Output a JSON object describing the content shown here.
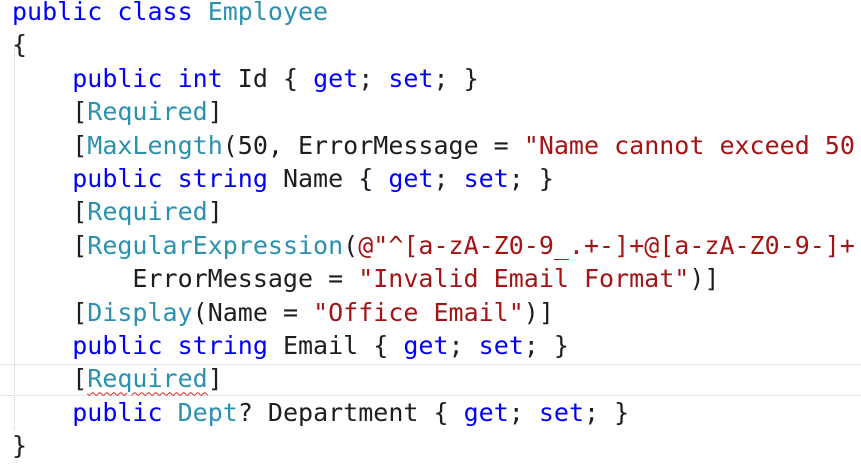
{
  "code": {
    "lines": [
      {
        "indent": "",
        "tokens": [
          {
            "t": "kw",
            "v": "public"
          },
          {
            "t": "id",
            "v": " "
          },
          {
            "t": "kw",
            "v": "class"
          },
          {
            "t": "id",
            "v": " "
          },
          {
            "t": "ty",
            "v": "Employee"
          }
        ]
      },
      {
        "indent": "",
        "tokens": [
          {
            "t": "id",
            "v": "{"
          }
        ]
      },
      {
        "indent": "    ",
        "tokens": [
          {
            "t": "kw",
            "v": "public"
          },
          {
            "t": "id",
            "v": " "
          },
          {
            "t": "kw",
            "v": "int"
          },
          {
            "t": "id",
            "v": " Id { "
          },
          {
            "t": "kw",
            "v": "get"
          },
          {
            "t": "id",
            "v": "; "
          },
          {
            "t": "kw",
            "v": "set"
          },
          {
            "t": "id",
            "v": "; }"
          }
        ]
      },
      {
        "indent": "    ",
        "tokens": [
          {
            "t": "id",
            "v": "["
          },
          {
            "t": "ty",
            "v": "Required"
          },
          {
            "t": "id",
            "v": "]"
          }
        ]
      },
      {
        "indent": "    ",
        "tokens": [
          {
            "t": "id",
            "v": "["
          },
          {
            "t": "ty",
            "v": "MaxLength"
          },
          {
            "t": "id",
            "v": "(50, ErrorMessage = "
          },
          {
            "t": "st",
            "v": "\"Name cannot exceed 50"
          }
        ]
      },
      {
        "indent": "    ",
        "tokens": [
          {
            "t": "kw",
            "v": "public"
          },
          {
            "t": "id",
            "v": " "
          },
          {
            "t": "kw",
            "v": "string"
          },
          {
            "t": "id",
            "v": " Name { "
          },
          {
            "t": "kw",
            "v": "get"
          },
          {
            "t": "id",
            "v": "; "
          },
          {
            "t": "kw",
            "v": "set"
          },
          {
            "t": "id",
            "v": "; }"
          }
        ]
      },
      {
        "indent": "    ",
        "tokens": [
          {
            "t": "id",
            "v": "["
          },
          {
            "t": "ty",
            "v": "Required"
          },
          {
            "t": "id",
            "v": "]"
          }
        ]
      },
      {
        "indent": "    ",
        "tokens": [
          {
            "t": "id",
            "v": "["
          },
          {
            "t": "ty",
            "v": "RegularExpression"
          },
          {
            "t": "id",
            "v": "("
          },
          {
            "t": "st",
            "v": "@\"^[a-zA-Z0-9_.+-]+@[a-zA-Z0-9-]+"
          }
        ]
      },
      {
        "indent": "        ",
        "tokens": [
          {
            "t": "id",
            "v": "ErrorMessage = "
          },
          {
            "t": "st",
            "v": "\"Invalid Email Format\""
          },
          {
            "t": "id",
            "v": ")]"
          }
        ]
      },
      {
        "indent": "    ",
        "tokens": [
          {
            "t": "id",
            "v": "["
          },
          {
            "t": "ty",
            "v": "Display"
          },
          {
            "t": "id",
            "v": "(Name = "
          },
          {
            "t": "st",
            "v": "\"Office Email\""
          },
          {
            "t": "id",
            "v": ")]"
          }
        ]
      },
      {
        "indent": "    ",
        "tokens": [
          {
            "t": "kw",
            "v": "public"
          },
          {
            "t": "id",
            "v": " "
          },
          {
            "t": "kw",
            "v": "string"
          },
          {
            "t": "id",
            "v": " Email { "
          },
          {
            "t": "kw",
            "v": "get"
          },
          {
            "t": "id",
            "v": "; "
          },
          {
            "t": "kw",
            "v": "set"
          },
          {
            "t": "id",
            "v": "; }"
          }
        ]
      },
      {
        "indent": "    ",
        "tokens": [
          {
            "t": "id",
            "v": "["
          },
          {
            "t": "ty",
            "v": "Required",
            "sq": true
          },
          {
            "t": "id",
            "v": "]"
          }
        ]
      },
      {
        "indent": "    ",
        "tokens": [
          {
            "t": "kw",
            "v": "public"
          },
          {
            "t": "id",
            "v": " "
          },
          {
            "t": "ty",
            "v": "Dept"
          },
          {
            "t": "id",
            "v": "? Department { "
          },
          {
            "t": "kw",
            "v": "get"
          },
          {
            "t": "id",
            "v": "; "
          },
          {
            "t": "kw",
            "v": "set"
          },
          {
            "t": "id",
            "v": "; }"
          }
        ]
      },
      {
        "indent": "",
        "tokens": [
          {
            "t": "id",
            "v": "}"
          }
        ]
      }
    ]
  },
  "colors": {
    "keyword": "#0000ff",
    "type": "#2b91af",
    "string": "#a31515",
    "identifier": "#1e1e1e",
    "error_squiggle": "#d92626"
  }
}
